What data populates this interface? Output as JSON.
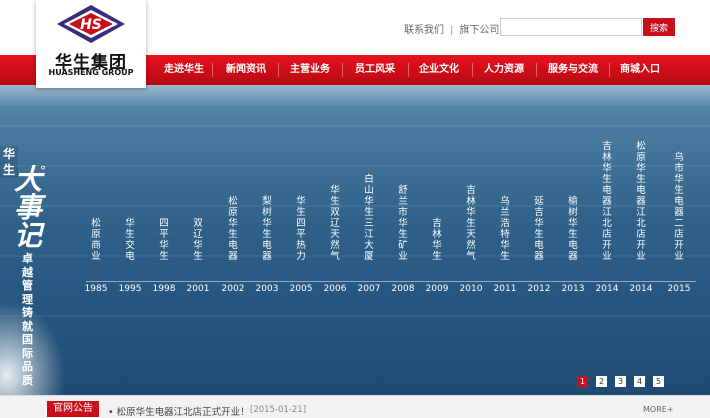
{
  "header": {
    "logo_cn": "华生集团",
    "logo_en": "HUASHENG GROUP",
    "contact_link": "联系我们",
    "separator": "|",
    "subsidiaries_link": "旗下公司",
    "search_button": "搜索",
    "brand_color": "#c8101c",
    "logo_color": "#3a2d7a"
  },
  "nav": {
    "items": [
      "走进华生",
      "新闻资讯",
      "主营业务",
      "员工风采",
      "企业文化",
      "人力资源",
      "服务与交流",
      "商城入口"
    ]
  },
  "banner": {
    "brand_small": "华生",
    "title_big": "大事记",
    "degree": "°",
    "slogan": "卓越管理铸就国际品质",
    "events": [
      {
        "text": "松原商业",
        "year": "1985"
      },
      {
        "text": "华生交电",
        "year": "1995"
      },
      {
        "text": "四平华生",
        "year": "1998"
      },
      {
        "text": "双辽华生",
        "year": "2001"
      },
      {
        "text": "松原华生电器",
        "year": "2002"
      },
      {
        "text": "梨树华生电器",
        "year": "2003"
      },
      {
        "text": "华生四平热力",
        "year": "2005"
      },
      {
        "text": "华生双辽天然气",
        "year": "2006"
      },
      {
        "text": "白山华生三江大厦",
        "year": "2007"
      },
      {
        "text": "舒兰市华生矿业",
        "year": "2008"
      },
      {
        "text": "吉林华生",
        "year": "2009"
      },
      {
        "text": "吉林华生天然气",
        "year": "2010"
      },
      {
        "text": "乌兰浩特华生",
        "year": "2011"
      },
      {
        "text": "延吉华生电器",
        "year": "2012"
      },
      {
        "text": "榆树华生电器",
        "year": "2013"
      },
      {
        "text": "吉林华生电器江北店开业",
        "year": "2014"
      },
      {
        "text": "松原华生电器江北店开业",
        "year": "2014"
      },
      {
        "text": "乌市华生电器二店开业",
        "year": "2015"
      }
    ],
    "pages": [
      "1",
      "2",
      "3",
      "4",
      "5"
    ],
    "active_page": "1"
  },
  "notice": {
    "label": "官网公告",
    "text": "• 松原华生电器江北店正式开业！",
    "date": "[2015-01-21]",
    "more": "MORE+"
  }
}
